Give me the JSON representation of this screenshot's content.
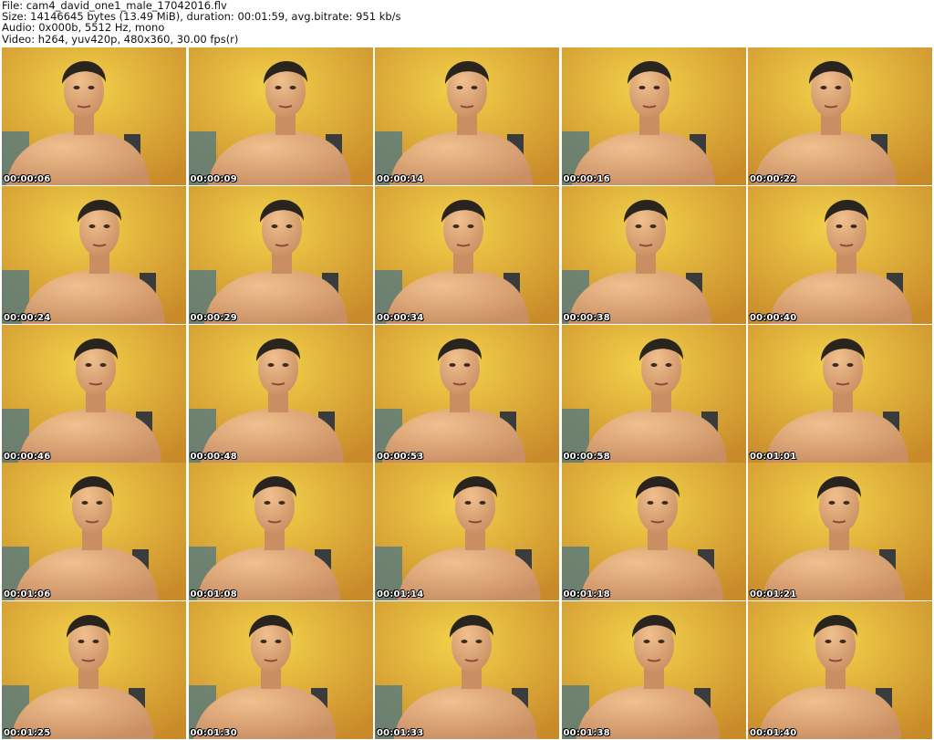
{
  "info": {
    "file": "File: cam4_david_one1_male_17042016.flv",
    "size": "Size: 14146645 bytes (13.49 MiB), duration: 00:01:59, avg.bitrate: 951 kb/s",
    "audio": "Audio: 0x000b, 5512 Hz, mono",
    "video": "Video: h264, yuv420p, 480x360, 30.00 fps(r)"
  },
  "thumbnails": [
    "00:00:06",
    "00:00:09",
    "00:00:14",
    "00:00:16",
    "00:00:22",
    "00:00:24",
    "00:00:29",
    "00:00:34",
    "00:00:38",
    "00:00:40",
    "00:00:46",
    "00:00:48",
    "00:00:53",
    "00:00:58",
    "00:01:01",
    "00:01:06",
    "00:01:08",
    "00:01:14",
    "00:01:18",
    "00:01:21",
    "00:01:25",
    "00:01:30",
    "00:01:33",
    "00:01:38",
    "00:01:40"
  ],
  "colors": {
    "wall_light": "#f2d14a",
    "wall_dark": "#c98a2a",
    "skin": "#f1c08e",
    "skin_shadow": "#c98f63",
    "hair": "#2a241e",
    "chair": "#3a3b3c",
    "curtain": "#5c7d7a"
  }
}
